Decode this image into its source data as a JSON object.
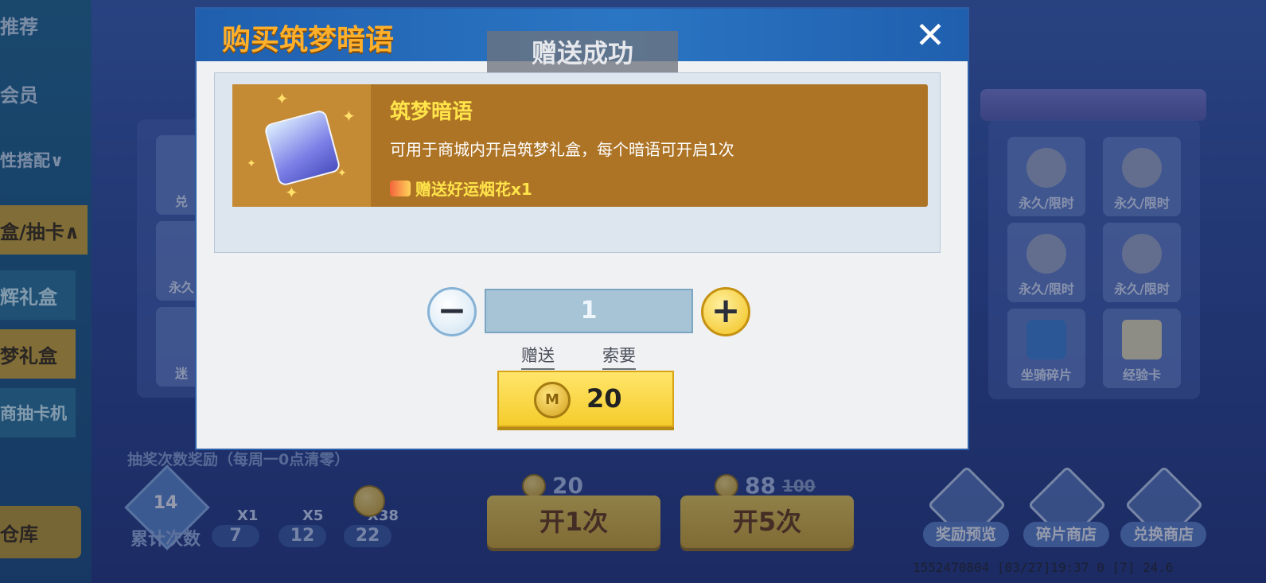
{
  "left_menu": {
    "items": [
      {
        "label": "推荐"
      },
      {
        "label": "会员"
      },
      {
        "label": "性搭配∨"
      },
      {
        "label": "盒/抽卡∧"
      },
      {
        "label": "辉礼盒"
      },
      {
        "label": "梦礼盒"
      },
      {
        "label": "商抽卡机"
      },
      {
        "label": "仓库"
      }
    ]
  },
  "left_tiles": [
    {
      "label": "兑"
    },
    {
      "label": "永久"
    },
    {
      "label": "迷"
    }
  ],
  "right_tiles": [
    {
      "label": "永久/限时"
    },
    {
      "label": "永久/限时"
    },
    {
      "label": "永久/限时"
    },
    {
      "label": "永久/限时"
    },
    {
      "label": "坐骑碎片"
    },
    {
      "label": "经验卡"
    }
  ],
  "bottom": {
    "title": "抽奖次数奖励（每周一0点清零）",
    "badge_count": "14",
    "cumulative_label": "累计次数",
    "milestones": [
      {
        "multiplier": "X1",
        "count": "7"
      },
      {
        "multiplier": "X5",
        "count": "12"
      },
      {
        "multiplier": "X38",
        "count": "22"
      }
    ],
    "open_once": {
      "label": "开1次",
      "price": "20"
    },
    "open_five": {
      "label": "开5次",
      "price": "88",
      "original_price": "100"
    },
    "shops": [
      {
        "label": "奖励预览",
        "icon": "eye-icon"
      },
      {
        "label": "碎片商店",
        "icon": "puzzle-icon"
      },
      {
        "label": "兑换商店",
        "icon": "gift-icon"
      }
    ],
    "footer_id": "1552470804   [03/27]19:37 0   [7]  24.6"
  },
  "modal": {
    "title": "购买筑梦暗语",
    "close_icon": "close-icon",
    "toast": "赠送成功",
    "item": {
      "name": "筑梦暗语",
      "description": "可用于商城内开启筑梦礼盒，每个暗语可开启1次",
      "bonus": "赠送好运烟花x1"
    },
    "quantity": "1",
    "gift_tab": "赠送",
    "request_tab": "索要",
    "price": "20",
    "currency_icon": "coin-icon",
    "colors": {
      "header_blue": "#1f5fae",
      "title_orange": "#ffb02a",
      "card_brown": "#ad7426",
      "price_yellow": "#f5cc2c"
    }
  }
}
